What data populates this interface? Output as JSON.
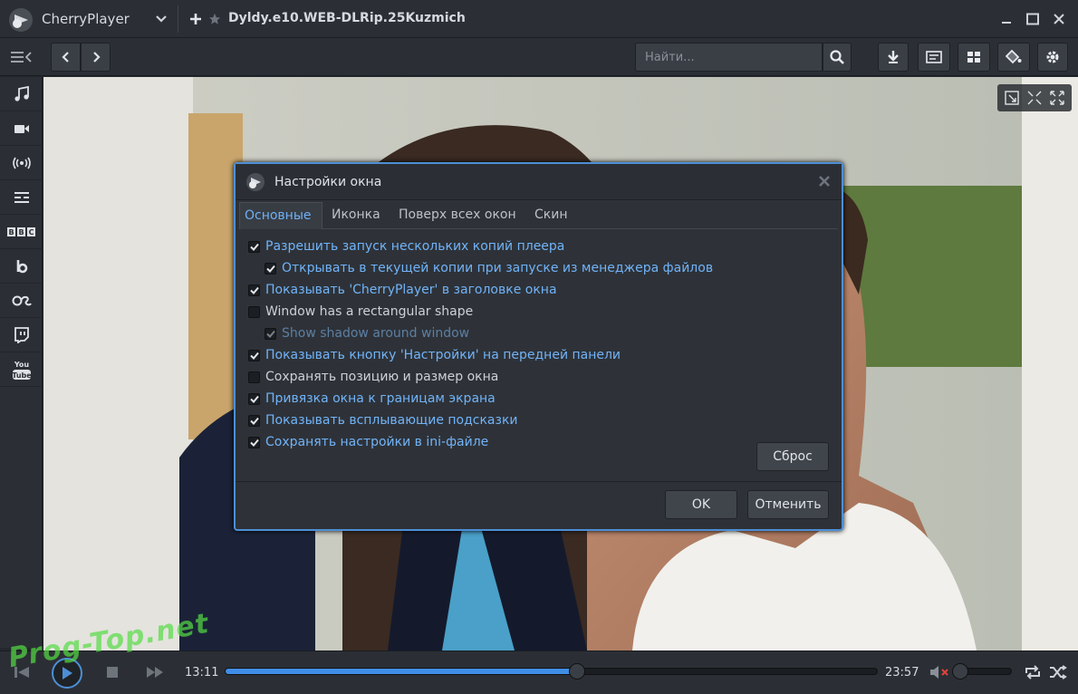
{
  "app": {
    "name": "CherryPlayer",
    "media_title": "Dyldy.e10.WEB-DLRip.25Kuzmich"
  },
  "toolbar": {
    "search_placeholder": "Найти..."
  },
  "sidebar": {
    "items": [
      "music-icon",
      "video-icon",
      "radio-icon",
      "tv-icon",
      "bbc-icon",
      "beatport-icon",
      "lastfm-icon",
      "twitch-icon",
      "youtube-icon"
    ]
  },
  "dialog": {
    "title": "Настройки окна",
    "tabs": [
      "Основные",
      "Иконка",
      "Поверх всех окон",
      "Скин"
    ],
    "active_tab": "Основные",
    "options": [
      {
        "label": "Разрешить запуск нескольких копий плеера",
        "checked": true,
        "indent": 0,
        "enabled": true
      },
      {
        "label": "Открывать в текущей копии при запуске из менеджера файлов",
        "checked": true,
        "indent": 1,
        "enabled": true
      },
      {
        "label": "Показывать 'CherryPlayer' в заголовке окна",
        "checked": true,
        "indent": 0,
        "enabled": true
      },
      {
        "label": "Window has a rectangular shape",
        "checked": false,
        "indent": 0,
        "enabled": true
      },
      {
        "label": "Show shadow around window",
        "checked": true,
        "indent": 1,
        "enabled": false
      },
      {
        "label": "Показывать кнопку 'Настройки' на передней панели",
        "checked": true,
        "indent": 0,
        "enabled": true
      },
      {
        "label": "Сохранять позицию и размер окна",
        "checked": false,
        "indent": 0,
        "enabled": true
      },
      {
        "label": "Привязка окна к границам экрана",
        "checked": true,
        "indent": 0,
        "enabled": true
      },
      {
        "label": "Показывать всплывающие подсказки",
        "checked": true,
        "indent": 0,
        "enabled": true
      },
      {
        "label": "Сохранять настройки в ini-файле",
        "checked": true,
        "indent": 0,
        "enabled": true
      }
    ],
    "reset_label": "Сброс",
    "ok_label": "OK",
    "cancel_label": "Отменить"
  },
  "playback": {
    "current_time": "13:11",
    "total_time": "23:57",
    "progress": 0.54,
    "volume": 0.0,
    "muted": true
  },
  "watermark": "Prog-Top.net",
  "colors": {
    "accent": "#3f8ee6",
    "checked_label": "#71b3f8",
    "dialog_border": "#4d8fd6"
  }
}
